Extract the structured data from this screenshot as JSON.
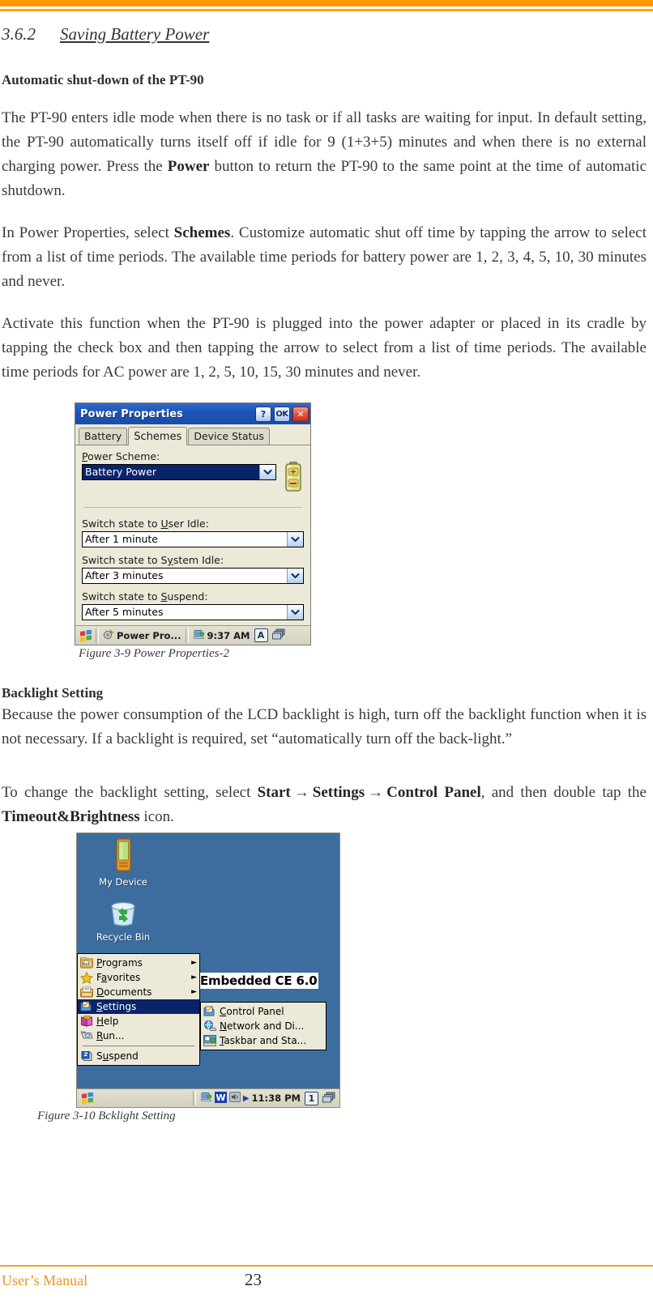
{
  "document": {
    "section_number": "3.6.2",
    "section_title": "Saving Battery Power",
    "subheading_1": "Automatic shut-down of the PT-90",
    "para_1": "The PT-90 enters idle mode when there is no task or if all tasks are waiting for input. In default setting, the PT-90 automatically turns itself off if idle for 9 (1+3+5) minutes and when there is no external charging power. Press the ",
    "para_1_b": "Power",
    "para_1_cont": " button to return the PT-90 to the same point at the time of automatic shutdown.",
    "para_2_a": "In Power Properties, select ",
    "para_2_b": "Schemes",
    "para_2_c": ". Customize automatic shut off time by tapping the arrow to select from a list of time periods. The available time periods for battery power are 1, 2, 3, 4, 5, 10, 30 minutes and never.",
    "para_3": "Activate this function when the PT-90 is plugged into the power adapter or placed in its cradle by tapping the check box and then tapping the arrow to select from a list of time periods. The available time periods for AC power are 1, 2, 5, 10, 15, 30 minutes and never.",
    "subheading_2": "Backlight Setting",
    "para_4": "Because the power consumption of the LCD backlight is high, turn off the backlight function when it is not necessary. If a backlight is required, set “automatically turn off the back-light.”",
    "para_5_a": "To change the backlight setting, select ",
    "para_5_start": "Start",
    "para_5_arrow1": "→",
    "para_5_settings": "Settings",
    "para_5_arrow2": "→",
    "para_5_cp": "Control Panel",
    "para_5_b": ", and then double tap the ",
    "para_5_icon": "Timeout&Brightness",
    "para_5_c": " icon.",
    "figure_1_caption": "Figure 3-9 Power Properties-2",
    "figure_2_caption": "Figure 3-10 Bcklight Setting"
  },
  "footer": {
    "left_text": "User’s Manual",
    "page_number": "23"
  },
  "colors": {
    "rule_orange": "#FF9900",
    "footer_orange": "#E8971C",
    "ce_title_blue": "#1d52b3",
    "ce_selection_blue": "#0a246a",
    "desktop_blue": "#3c6d9e",
    "dialog_face": "#ece9d8"
  },
  "shot1": {
    "title": "Power Properties",
    "titlebar_buttons": [
      {
        "name": "help-button",
        "label": "?"
      },
      {
        "name": "ok-button",
        "label": "OK"
      },
      {
        "name": "close-button",
        "label": "✕"
      }
    ],
    "tabs": [
      {
        "label": "Battery",
        "active": false
      },
      {
        "label": "Schemes",
        "active": true
      },
      {
        "label": "Device Status",
        "active": false
      }
    ],
    "fields": [
      {
        "label_pre": "",
        "label_u": "P",
        "label_post": "ower Scheme:",
        "value": "Battery Power",
        "selected": true
      },
      {
        "label_pre": "Switch state to ",
        "label_u": "U",
        "label_post": "ser Idle:",
        "value": "After 1 minute",
        "selected": false
      },
      {
        "label_pre": "Switch state to S",
        "label_u": "y",
        "label_post": "stem Idle:",
        "value": "After 3 minutes",
        "selected": false
      },
      {
        "label_pre": "Switch state to ",
        "label_u": "S",
        "label_post": "uspend:",
        "value": "After 5 minutes",
        "selected": false
      }
    ],
    "taskbar": {
      "start_icon": "windows-start-icon",
      "task_label": "Power Pro...",
      "task_icon": "power-properties-icon",
      "tray_icon": "desktop-connection-icon",
      "clock": "9:37 AM",
      "input_indicator": "A",
      "tray_icon_2": "window-stack-icon"
    }
  },
  "shot2": {
    "desktop_icons": [
      {
        "label": "My Device",
        "icon": "handheld-device-icon"
      },
      {
        "label": "Recycle Bin",
        "icon": "recycle-bin-icon"
      }
    ],
    "ce_badge": "Embedded CE 6.0",
    "start_menu": [
      {
        "label_u": "P",
        "label_rest": "rograms",
        "icon": "programs-folder-icon",
        "has_sub": true,
        "selected": false
      },
      {
        "label_pre": "F",
        "label_u": "a",
        "label_rest": "vorites",
        "icon": "favorites-star-icon",
        "has_sub": true,
        "selected": false
      },
      {
        "label_u": "D",
        "label_rest": "ocuments",
        "icon": "documents-folder-icon",
        "has_sub": true,
        "selected": false
      },
      {
        "label_u": "S",
        "label_rest": "ettings",
        "icon": "settings-icon",
        "has_sub": false,
        "selected": true
      },
      {
        "label_u": "H",
        "label_rest": "elp",
        "icon": "help-book-icon",
        "has_sub": false,
        "selected": false
      },
      {
        "label_u": "R",
        "label_rest": "un...",
        "icon": "run-icon",
        "has_sub": false,
        "selected": false
      },
      {
        "label_pre": "S",
        "label_u": "u",
        "label_rest": "spend",
        "icon": "suspend-icon",
        "has_sub": false,
        "selected": false,
        "after_divider": true
      }
    ],
    "settings_submenu": [
      {
        "label_u": "C",
        "label_rest": "ontrol Panel",
        "icon": "control-panel-icon"
      },
      {
        "label_u": "N",
        "label_rest": "etwork and Di...",
        "icon": "network-icon"
      },
      {
        "label_u": "T",
        "label_rest": "askbar and Sta...",
        "icon": "taskbar-icon"
      }
    ],
    "taskbar": {
      "start_icon": "windows-start-icon",
      "tray_icons": [
        "desktop-connection-icon",
        "word-icon",
        "volume-icon",
        "play-arrow-icon"
      ],
      "clock": "11:38 PM",
      "input_indicator": "1",
      "tray_icon_2": "window-stack-icon"
    }
  }
}
